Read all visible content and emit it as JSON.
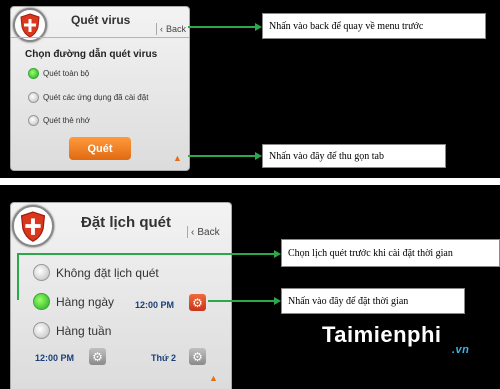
{
  "top_panel": {
    "title": "Quét virus",
    "back_label": "Back",
    "subtitle": "Chọn đường dẫn quét virus",
    "options": [
      {
        "label": "Quét toàn bộ",
        "selected": true
      },
      {
        "label": "Quét các ứng dụng đã cài đặt",
        "selected": false
      },
      {
        "label": "Quét thẻ nhớ",
        "selected": false
      }
    ],
    "scan_button": "Quét",
    "collapse_icon": "chevron-up-icon"
  },
  "bottom_panel": {
    "title": "Đặt lịch quét",
    "back_label": "Back",
    "options": [
      {
        "label": "Không đặt lịch quét",
        "selected": false
      },
      {
        "label": "Hàng ngày",
        "selected": true
      },
      {
        "label": "Hàng tuần",
        "selected": false
      }
    ],
    "daily_time": "12:00 PM",
    "weekly_time": "12:00 PM",
    "weekly_day": "Thứ 2",
    "collapse_icon": "chevron-up-icon"
  },
  "callouts": {
    "back": "Nhấn vào back để quay về menu trước",
    "collapse": "Nhấn vào đây để thu gọn tab",
    "choose_schedule": "Chọn lịch quét trước khi cài đặt thời gian",
    "set_time": "Nhấn vào đây để đặt thời gian"
  },
  "brand": {
    "name": "Taimienphi",
    "suffix": ".vn"
  },
  "colors": {
    "accent_orange": "#e36e14",
    "callout_arrow": "#2ca84a",
    "selected_radio": "#33aa33",
    "time_text": "#1a3e7a"
  }
}
